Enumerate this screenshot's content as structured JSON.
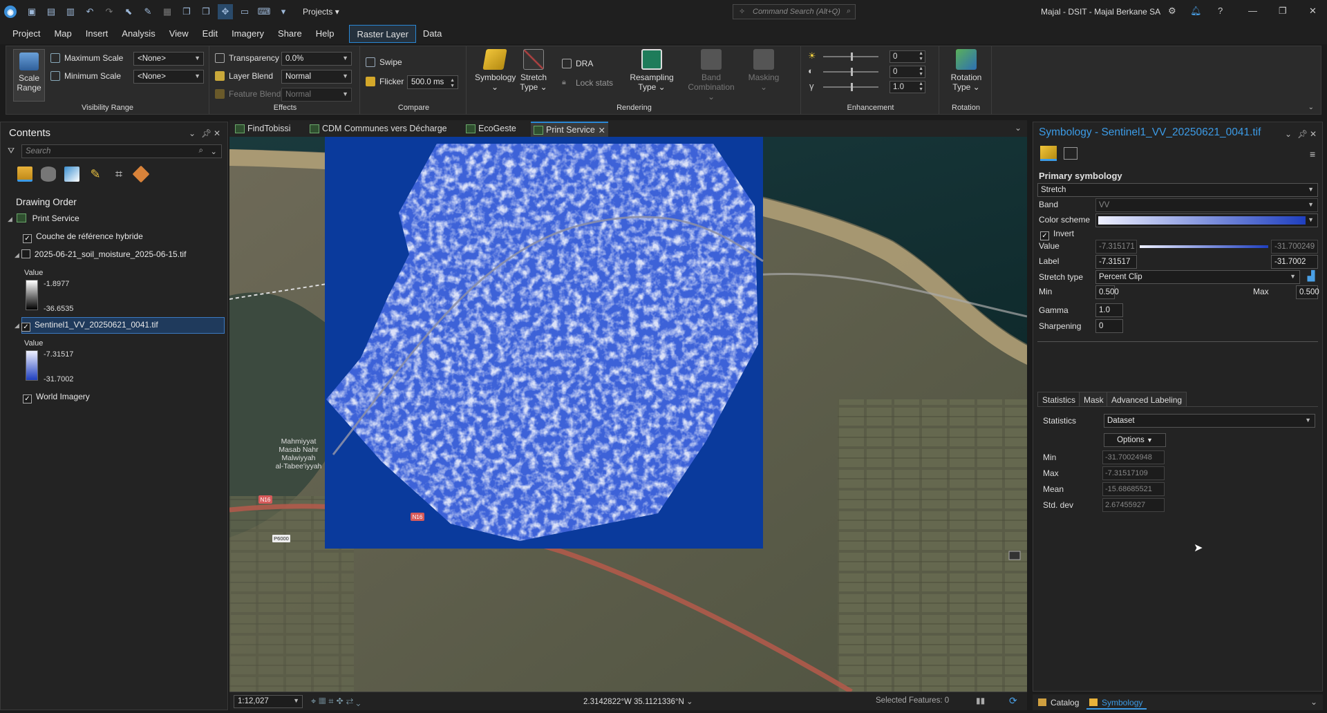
{
  "titlebar": {
    "projects_label": "Projects",
    "command_search_placeholder": "Command Search (Alt+Q)",
    "user_label": "Majal - DSIT - Majal Berkane SA"
  },
  "menu": [
    "Project",
    "Map",
    "Insert",
    "Analysis",
    "View",
    "Edit",
    "Imagery",
    "Share",
    "Help",
    "Raster Layer",
    "Data"
  ],
  "ribbon": {
    "visibility": {
      "scale_range_label": "Scale Range",
      "max_scale_label": "Maximum Scale",
      "min_scale_label": "Minimum Scale",
      "max_scale_value": "<None>",
      "min_scale_value": "<None>",
      "group_label": "Visibility Range"
    },
    "effects": {
      "transparency_label": "Transparency",
      "transparency_value": "0.0%",
      "layer_blend_label": "Layer Blend",
      "layer_blend_value": "Normal",
      "feature_blend_label": "Feature Blend",
      "feature_blend_value": "Normal",
      "group_label": "Effects"
    },
    "compare": {
      "swipe_label": "Swipe",
      "flicker_label": "Flicker",
      "flicker_value": "500.0  ms",
      "group_label": "Compare"
    },
    "rendering": {
      "symbology_label": "Symbology",
      "stretch_type_label": "Stretch Type",
      "dra_label": "DRA",
      "lock_stats_label": "Lock stats",
      "resampling_label": "Resampling Type",
      "band_combination_label": "Band Combination",
      "masking_label": "Masking",
      "group_label": "Rendering"
    },
    "enhancement": {
      "brightness": "0",
      "contrast": "0",
      "gamma": "1.0",
      "group_label": "Enhancement"
    },
    "rotation": {
      "rotation_type_label": "Rotation Type",
      "group_label": "Rotation"
    }
  },
  "contents": {
    "title": "Contents",
    "search_placeholder": "Search",
    "drawing_order_label": "Drawing Order",
    "map_name": "Print Service",
    "layers": [
      {
        "name": "Couche de référence hybride",
        "checked": true
      },
      {
        "name": "2025-06-21_soil_moisture_2025-06-15.tif",
        "checked": false,
        "legend_title": "Value",
        "legend_high": "-1.8977",
        "legend_low": "-36.6535"
      },
      {
        "name": "Sentinel1_VV_20250621_0041.tif",
        "checked": true,
        "legend_title": "Value",
        "legend_high": "-7.31517",
        "legend_low": "-31.7002"
      },
      {
        "name": "World Imagery",
        "checked": true
      }
    ]
  },
  "map_tabs": [
    "FindTobissi",
    "CDM Communes vers Décharge",
    "EcoGeste",
    "Print Service"
  ],
  "map": {
    "place_label_lines": [
      "Mahmiyyat",
      "Masab Nahr",
      "Malwiyyah",
      "al-Tabee'iyyah"
    ],
    "road_labels": [
      "N16",
      "N16",
      "P6000"
    ],
    "scale": "1:12,027",
    "coordinates": "2.3142822°W 35.1121336°N",
    "selected_features": "Selected Features: 0"
  },
  "symbology": {
    "title": "Symbology - Sentinel1_VV_20250621_0041.tif",
    "primary_label": "Primary symbology",
    "primary_value": "Stretch",
    "band_label": "Band",
    "band_value": "VV",
    "color_scheme_label": "Color scheme",
    "invert_label": "Invert",
    "value_label": "Value",
    "value_min": "-7.315171",
    "value_max": "-31.700249",
    "label_label": "Label",
    "label_min": "-7.31517",
    "label_max": "-31.7002",
    "stretch_type_label": "Stretch type",
    "stretch_type_value": "Percent Clip",
    "min_label": "Min",
    "min_value": "0.500",
    "max_label": "Max",
    "max_value": "0.500",
    "gamma_label": "Gamma",
    "gamma_value": "1.0",
    "sharpening_label": "Sharpening",
    "sharpening_value": "0",
    "tabs": [
      "Statistics",
      "Mask",
      "Advanced Labeling"
    ],
    "statistics_label": "Statistics",
    "statistics_value": "Dataset",
    "options_label": "Options",
    "stats": [
      {
        "label": "Min",
        "value": "-31.70024948"
      },
      {
        "label": "Max",
        "value": "-7.31517109"
      },
      {
        "label": "Mean",
        "value": "-15.68685521"
      },
      {
        "label": "Std. dev",
        "value": "2.67455927"
      }
    ]
  },
  "bottom_tabs": [
    "Catalog",
    "Symbology"
  ],
  "colors": {
    "accent": "#3c9be6",
    "raster_dark": "#0a3a9c",
    "raster_light": "#e8ecfb"
  }
}
